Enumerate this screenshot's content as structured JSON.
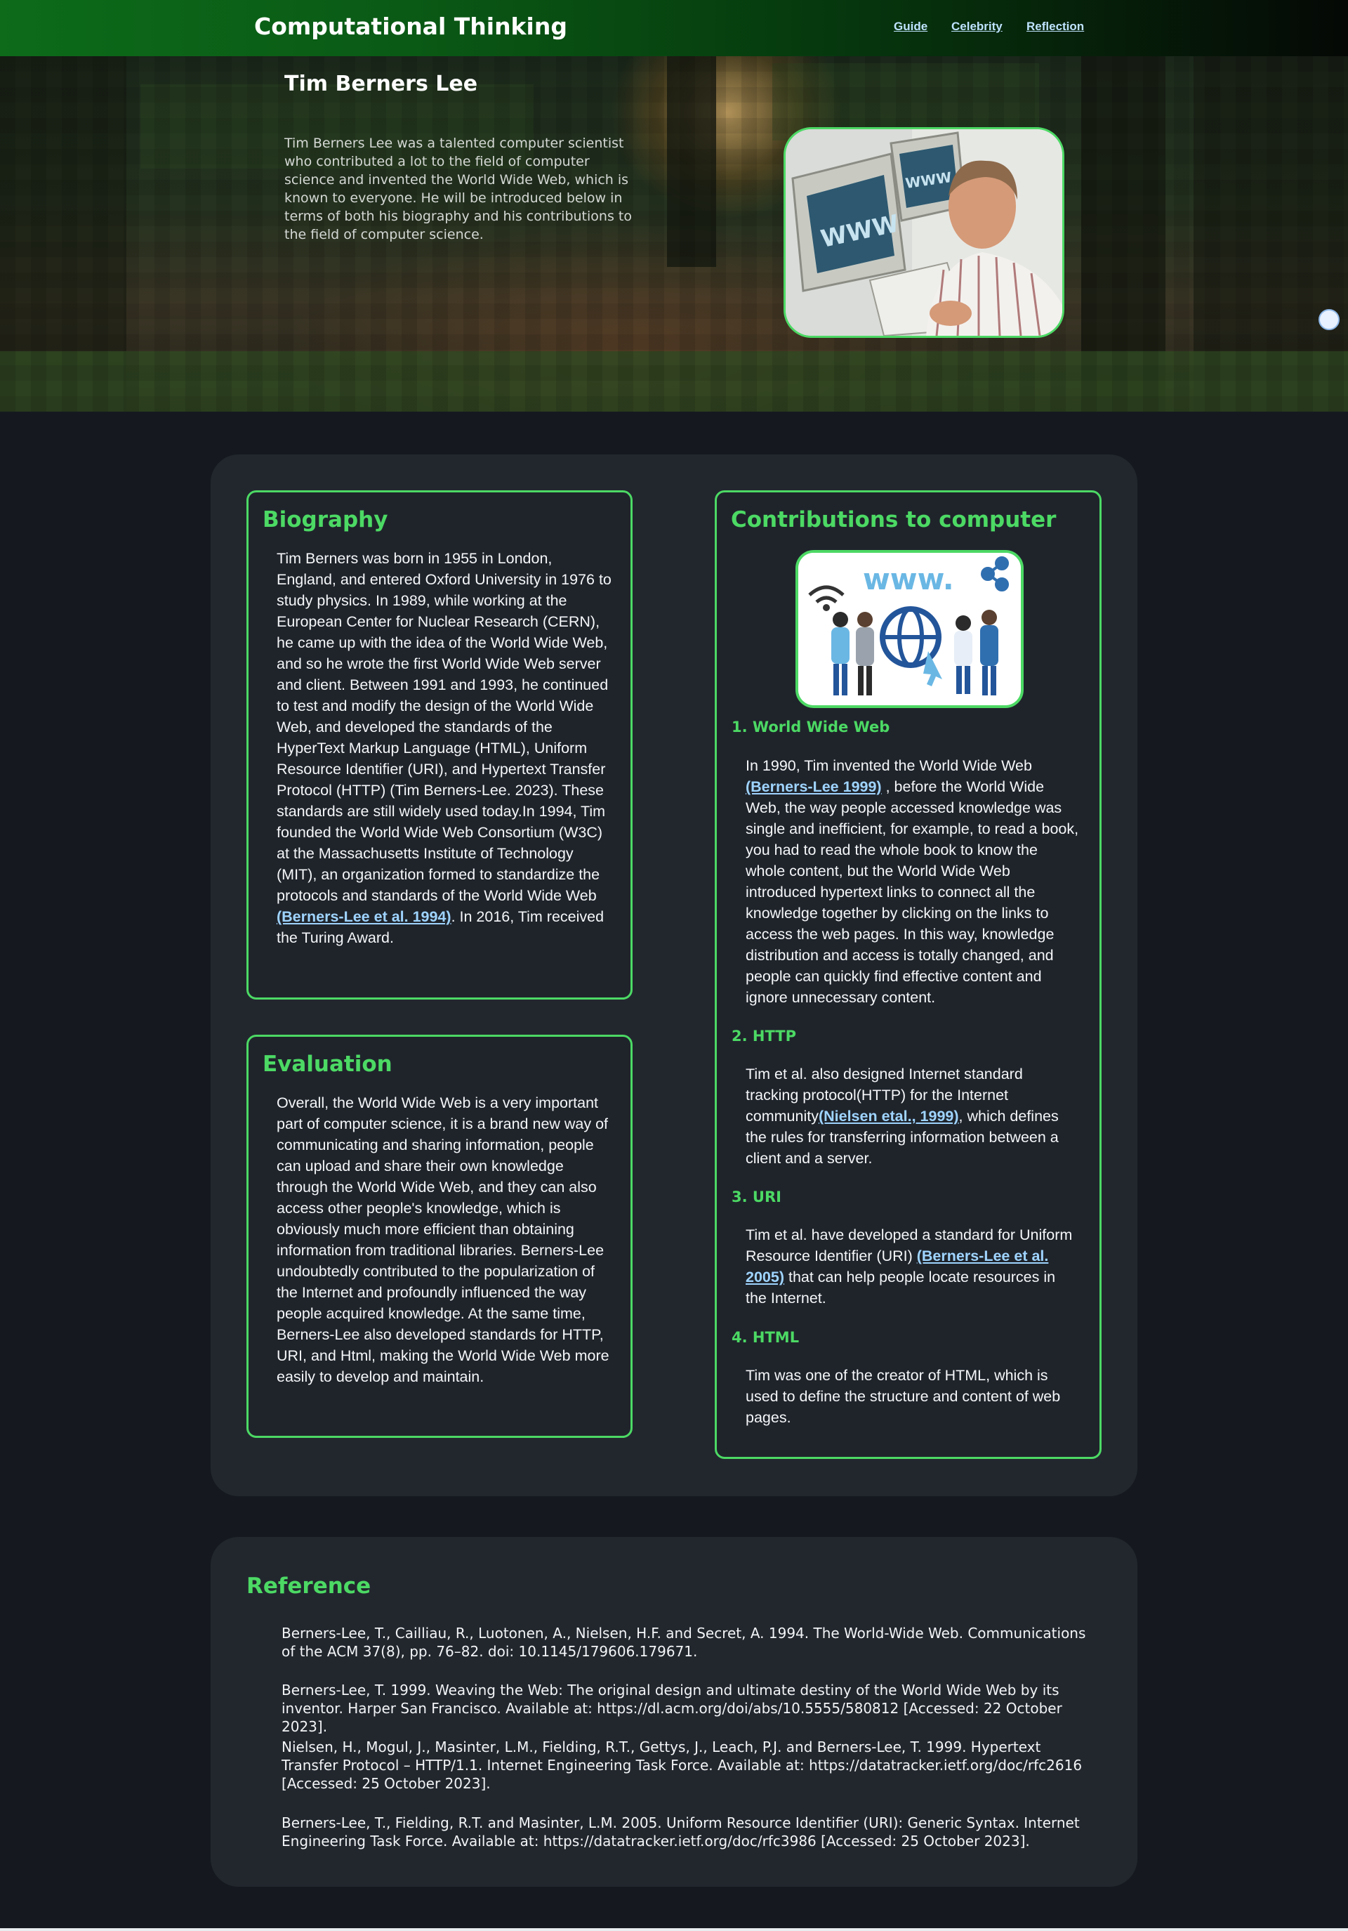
{
  "nav": {
    "brand": "Computational Thinking",
    "links": [
      "Guide",
      "Celebrity",
      "Reflection"
    ]
  },
  "hero": {
    "title": "Tim Berners Lee",
    "intro": "Tim Berners Lee was a talented computer scientist who contributed a lot to the field of computer science and invented the World Wide Web, which is known to everyone. He will be introduced below in terms of both his biography and his contributions to the field of computer science.",
    "photo_text": [
      "WWW",
      "WWW"
    ]
  },
  "biography": {
    "title": "Biography",
    "text_before": "Tim Berners was born in 1955 in London, England, and entered Oxford University in 1976 to study physics. In 1989, while working at the European Center for Nuclear Research (CERN), he came up with the idea of the World Wide Web, and so he wrote the first World Wide Web server and client. Between 1991 and 1993, he continued to test and modify the design of the World Wide Web, and developed the standards of the HyperText Markup Language (HTML), Uniform Resource Identifier (URI), and Hypertext Transfer Protocol (HTTP) (Tim Berners-Lee. 2023). These standards are still widely used today.In 1994, Tim founded the World Wide Web Consortium (W3C) at the Massachusetts Institute of Technology (MIT), an organization formed to standardize the protocols and standards of the World Wide Web ",
    "link": "(Berners-Lee et al. 1994)",
    "text_after": ". In 2016, Tim received the Turing Award."
  },
  "evaluation": {
    "title": "Evaluation",
    "text": "Overall, the World Wide Web is a very important part of computer science, it is a brand new way of communicating and sharing information, people can upload and share their own knowledge through the World Wide Web, and they can also access other people's knowledge, which is obviously much more efficient than obtaining information from traditional libraries. Berners-Lee undoubtedly contributed to the popularization of the Internet and profoundly influenced the way people acquired knowledge. At the same time, Berners-Lee also developed standards for HTTP, URI, and Html, making the World Wide Web more easily to develop and maintain."
  },
  "contributions": {
    "title": "Contributions to computer",
    "image_text": "www.",
    "items": [
      {
        "heading": "1. World Wide Web",
        "before": "In 1990, Tim invented the World Wide Web ",
        "link": "(Berners-Lee 1999)",
        "after": " , before the World Wide Web, the way people accessed knowledge was single and inefficient, for example, to read a book, you had to read the whole book to know the whole content, but the World Wide Web introduced hypertext links to connect all the knowledge together by clicking on the links to access the web pages. In this way, knowledge distribution and access is totally changed, and people can quickly find effective content and ignore unnecessary content."
      },
      {
        "heading": "2. HTTP",
        "before": "Tim et al. also designed Internet standard tracking protocol(HTTP) for the Internet community",
        "link": "(Nielsen etal., 1999)",
        "after": ", which defines the rules for transferring information between a client and a server."
      },
      {
        "heading": "3. URI",
        "before": "Tim et al. have developed a standard for Uniform Resource Identifier (URI) ",
        "link": "(Berners-Lee et al. 2005)",
        "after": " that can help people locate resources in the Internet."
      },
      {
        "heading": "4. HTML",
        "before": "Tim was one of the creator of HTML, which is used to define the structure and content of web pages.",
        "link": "",
        "after": ""
      }
    ]
  },
  "reference": {
    "title": "Reference",
    "items": [
      "Berners-Lee, T., Cailliau, R., Luotonen, A., Nielsen, H.F. and Secret, A. 1994. The World-Wide Web. Communications of the ACM 37(8), pp. 76–82. doi: 10.1145/179606.179671.",
      "Berners-Lee, T. 1999. Weaving the Web: The original design and ultimate destiny of the World Wide Web by its inventor. Harper San Francisco. Available at: https://dl.acm.org/doi/abs/10.5555/580812 [Accessed: 22 October 2023].",
      "Nielsen, H., Mogul, J., Masinter, L.M., Fielding, R.T., Gettys, J., Leach, P.J. and Berners-Lee, T. 1999. Hypertext Transfer Protocol – HTTP/1.1. Internet Engineering Task Force. Available at: https://datatracker.ietf.org/doc/rfc2616 [Accessed: 25 October 2023].",
      "Berners-Lee, T., Fielding, R.T. and Masinter, L.M. 2005. Uniform Resource Identifier (URI): Generic Syntax. Internet Engineering Task Force. Available at: https://datatracker.ietf.org/doc/rfc3986 [Accessed: 25 October 2023]."
    ]
  },
  "colors": {
    "accent": "#4cd964",
    "link": "#9fd4ff",
    "page_bg": "#15191f",
    "panel_bg": "#22272e"
  }
}
